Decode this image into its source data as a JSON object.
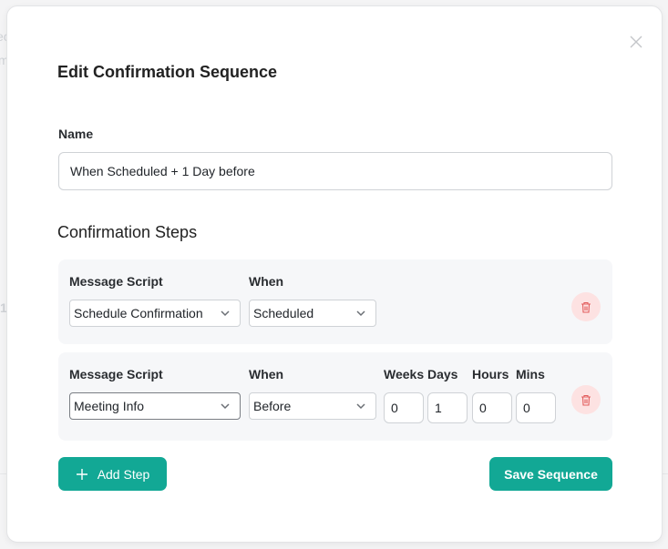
{
  "modal": {
    "title": "Edit Confirmation Sequence",
    "close_icon": "close-icon"
  },
  "name_field": {
    "label": "Name",
    "value": "When Scheduled + 1 Day before"
  },
  "steps_section": {
    "title": "Confirmation Steps",
    "steps": [
      {
        "message_script_label": "Message Script",
        "message_script_value": "Schedule Confirmation",
        "when_label": "When",
        "when_value": "Scheduled"
      },
      {
        "message_script_label": "Message Script",
        "message_script_value": "Meeting Info",
        "when_label": "When",
        "when_value": "Before",
        "weeks_label": "Weeks",
        "weeks_value": "0",
        "days_label": "Days",
        "days_value": "1",
        "hours_label": "Hours",
        "hours_value": "0",
        "mins_label": "Mins",
        "mins_value": "0"
      }
    ]
  },
  "actions": {
    "add_step_label": "Add Step",
    "save_label": "Save Sequence"
  },
  "colors": {
    "accent": "#12a895",
    "danger_bg": "#fde2e2",
    "danger_icon": "#e25c5c"
  }
}
